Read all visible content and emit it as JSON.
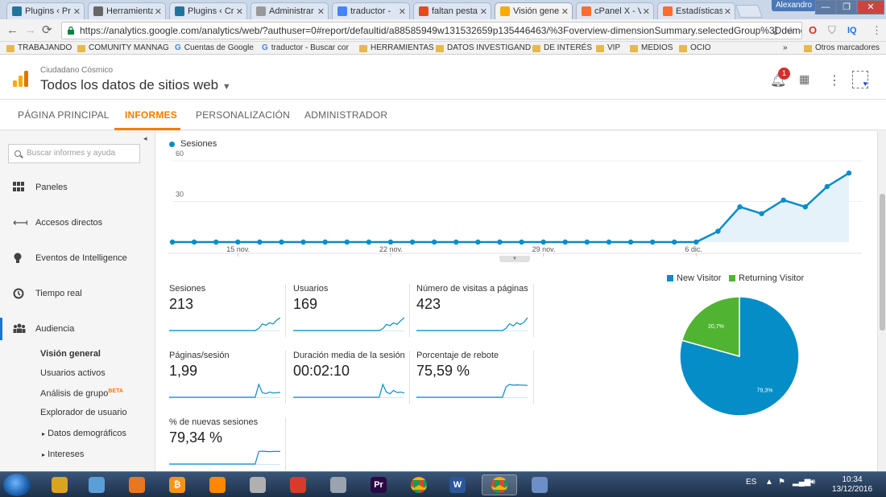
{
  "browser": {
    "tabs": [
      {
        "title": "Plugins ‹ Pr",
        "icon": "wordpress-icon"
      },
      {
        "title": "Herramientas",
        "icon": "settings-icon"
      },
      {
        "title": "Plugins ‹ Cre",
        "icon": "wordpress-icon"
      },
      {
        "title": "Administrar",
        "icon": "page-icon"
      },
      {
        "title": "traductor -",
        "icon": "google-icon"
      },
      {
        "title": "faltan pesta",
        "icon": "search-result-icon"
      },
      {
        "title": "Visión gene",
        "icon": "analytics-icon",
        "active": true
      },
      {
        "title": "cPanel X - V",
        "icon": "cpanel-icon"
      },
      {
        "title": "Estadísticas",
        "icon": "cpanel-icon"
      }
    ],
    "close_glyph": "✕",
    "user": "Alexandro",
    "url": "https://analytics.google.com/analytics/web/?authuser=0#report/defaultid/a88585949w131532659p135446463/%3Foverview-dimensionSummary.selectedGroup%3Ddemog",
    "extension_label": "IQ",
    "bookmarks": [
      {
        "label": "TRABAJANDO",
        "type": "folder"
      },
      {
        "label": "COMUNITY MANNAG",
        "type": "folder"
      },
      {
        "label": "Cuentas de Google",
        "type": "google"
      },
      {
        "label": "traductor - Buscar cor",
        "type": "google"
      },
      {
        "label": "HERRAMIENTAS",
        "type": "folder"
      },
      {
        "label": "DATOS INVESTIGAND",
        "type": "folder"
      },
      {
        "label": "DE INTERÉS",
        "type": "folder"
      },
      {
        "label": "VIP",
        "type": "folder"
      },
      {
        "label": "MEDIOS",
        "type": "folder"
      },
      {
        "label": "OCIO",
        "type": "folder"
      }
    ],
    "more_bookmarks": "»",
    "other_bookmarks": "Otros marcadores"
  },
  "ga": {
    "account": "Ciudadano Cósmico",
    "property": "Todos los datos de sitios web",
    "notification_count": "1",
    "tabs": [
      "PÁGINA PRINCIPAL",
      "INFORMES",
      "PERSONALIZACIÓN",
      "ADMINISTRADOR"
    ],
    "active_tab": "INFORMES",
    "search_placeholder": "Buscar informes y ayuda",
    "sidebar": [
      {
        "label": "Paneles",
        "icon": "dashboard-icon"
      },
      {
        "label": "Accesos directos",
        "icon": "shortcut-icon"
      },
      {
        "label": "Eventos de Intelligence",
        "icon": "lightbulb-icon"
      },
      {
        "label": "Tiempo real",
        "icon": "clock-icon"
      },
      {
        "label": "Audiencia",
        "icon": "audience-icon",
        "active": true
      }
    ],
    "sub_items": [
      {
        "label": "Visión general",
        "selected": true
      },
      {
        "label": "Usuarios activos"
      },
      {
        "label": "Análisis de grupo",
        "badge": "BETA"
      },
      {
        "label": "Explorador de usuario"
      },
      {
        "label": "Datos demográficos",
        "expandable": true
      },
      {
        "label": "Intereses",
        "expandable": true
      }
    ]
  },
  "chart_data": [
    {
      "type": "area",
      "legend": "Sesiones",
      "series": [
        {
          "name": "Sesiones",
          "color": "#058dc7",
          "values": [
            0,
            0,
            0,
            0,
            0,
            0,
            0,
            0,
            0,
            0,
            0,
            0,
            0,
            0,
            0,
            0,
            0,
            0,
            0,
            0,
            0,
            0,
            0,
            0,
            0,
            8,
            26,
            21,
            31,
            26,
            41,
            51
          ]
        }
      ],
      "x_tick_labels": [
        "15 nov.",
        "22 nov.",
        "29 nov.",
        "6 dic."
      ],
      "x_tick_indices": [
        3,
        10,
        17,
        24
      ],
      "y_ticks": [
        30,
        60
      ],
      "ylim": [
        0,
        60
      ]
    },
    {
      "type": "pie",
      "title": "",
      "slices": [
        {
          "name": "New Visitor",
          "value": 79.3,
          "label": "79,3%",
          "color": "#058dc7"
        },
        {
          "name": "Returning Visitor",
          "value": 20.7,
          "label": "20,7%",
          "color": "#50b432"
        }
      ]
    }
  ],
  "metrics": [
    {
      "label": "Sesiones",
      "value": "213",
      "spark": [
        0,
        0,
        0,
        0,
        0,
        0,
        0,
        0,
        0,
        0,
        0,
        0,
        0,
        0,
        0,
        0,
        0,
        0,
        0,
        0,
        0,
        0,
        0,
        0,
        0,
        8,
        26,
        21,
        31,
        26,
        41,
        51
      ]
    },
    {
      "label": "Usuarios",
      "value": "169",
      "spark": [
        0,
        0,
        0,
        0,
        0,
        0,
        0,
        0,
        0,
        0,
        0,
        0,
        0,
        0,
        0,
        0,
        0,
        0,
        0,
        0,
        0,
        0,
        0,
        0,
        0,
        6,
        20,
        16,
        25,
        20,
        32,
        42
      ]
    },
    {
      "label": "Número de visitas a páginas",
      "value": "423",
      "spark": [
        0,
        0,
        0,
        0,
        0,
        0,
        0,
        0,
        0,
        0,
        0,
        0,
        0,
        0,
        0,
        0,
        0,
        0,
        0,
        0,
        0,
        0,
        0,
        0,
        0,
        16,
        48,
        32,
        55,
        42,
        58,
        90
      ]
    },
    {
      "label": "Páginas/sesión",
      "value": "1,99",
      "spark": [
        0,
        0,
        0,
        0,
        0,
        0,
        0,
        0,
        0,
        0,
        0,
        0,
        0,
        0,
        0,
        0,
        0,
        0,
        0,
        0,
        0,
        0,
        0,
        0,
        0,
        4.5,
        1.6,
        1.3,
        1.8,
        1.5,
        1.6,
        1.7
      ]
    },
    {
      "label": "Duración media de la sesión",
      "value": "00:02:10",
      "spark": [
        0,
        0,
        0,
        0,
        0,
        0,
        0,
        0,
        0,
        0,
        0,
        0,
        0,
        0,
        0,
        0,
        0,
        0,
        0,
        0,
        0,
        0,
        0,
        0,
        0,
        300,
        120,
        80,
        160,
        110,
        120,
        100
      ]
    },
    {
      "label": "Porcentaje de rebote",
      "value": "75,59 %",
      "spark": [
        0,
        0,
        0,
        0,
        0,
        0,
        0,
        0,
        0,
        0,
        0,
        0,
        0,
        0,
        0,
        0,
        0,
        0,
        0,
        0,
        0,
        0,
        0,
        0,
        0,
        65,
        80,
        75,
        77,
        76,
        75,
        74
      ]
    },
    {
      "label": "% de nuevas sesiones",
      "value": "79,34 %",
      "spark": [
        0,
        0,
        0,
        0,
        0,
        0,
        0,
        0,
        0,
        0,
        0,
        0,
        0,
        0,
        0,
        0,
        0,
        0,
        0,
        0,
        0,
        0,
        0,
        0,
        0,
        80,
        82,
        80,
        79,
        80,
        81,
        80
      ]
    }
  ],
  "taskbar": {
    "apps": [
      {
        "name": "file-explorer-icon",
        "color": "#d9a520"
      },
      {
        "name": "photos-icon",
        "color": "#5aa0d8"
      },
      {
        "name": "media-player-icon",
        "color": "#e87722"
      },
      {
        "name": "bitcoin-icon",
        "color": "#f7931a",
        "glyph": "₿"
      },
      {
        "name": "vlc-icon",
        "color": "#ff8800"
      },
      {
        "name": "burner-icon",
        "color": "#b0b0b0"
      },
      {
        "name": "ccleaner-icon",
        "color": "#d83b2a"
      },
      {
        "name": "hdd-icon",
        "color": "#9aa4b0"
      },
      {
        "name": "premiere-icon",
        "color": "#2a0a45",
        "glyph": "Pr"
      },
      {
        "name": "chrome-icon",
        "color": "#4285f4"
      },
      {
        "name": "word-icon",
        "color": "#2b579a",
        "glyph": "W"
      },
      {
        "name": "chrome-active-icon",
        "color": "#4285f4",
        "active": true
      },
      {
        "name": "paint-icon",
        "color": "#6d8fc7"
      }
    ],
    "lang": "ES",
    "time": "10:34",
    "date": "13/12/2016"
  }
}
